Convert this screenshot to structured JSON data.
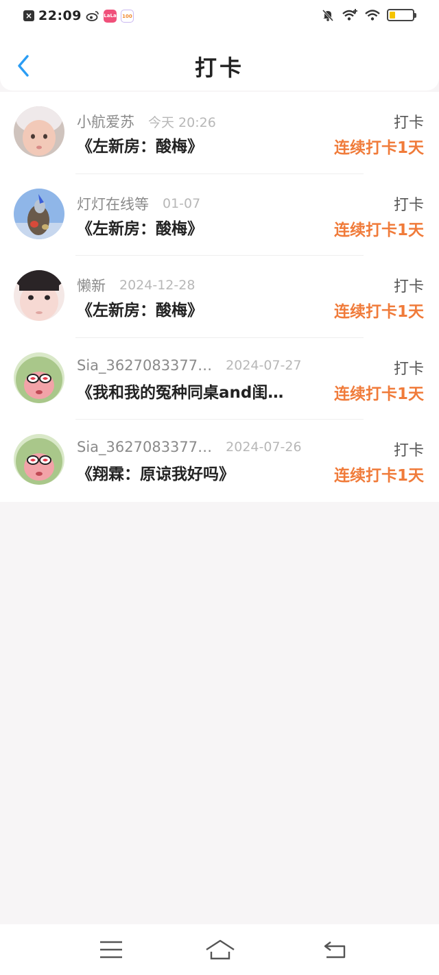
{
  "status_bar": {
    "time": "22:09",
    "app1_label": "LaLa",
    "app2_label": "100",
    "battery_level": 0.25
  },
  "header": {
    "title": "打卡"
  },
  "checkins": [
    {
      "username": "小航爱苏",
      "date": "今天 20:26",
      "song": "《左新房：酸梅》",
      "tag": "打卡",
      "streak": "连续打卡1天"
    },
    {
      "username": "灯灯在线等",
      "date": "01-07",
      "song": "《左新房：酸梅》",
      "tag": "打卡",
      "streak": "连续打卡1天"
    },
    {
      "username": "懒新",
      "date": "2024-12-28",
      "song": "《左新房：酸梅》",
      "tag": "打卡",
      "streak": "连续打卡1天"
    },
    {
      "username": "Sia_3627083377…",
      "date": "2024-07-27",
      "song": "《我和我的冤种同桌and闺…",
      "tag": "打卡",
      "streak": "连续打卡1天"
    },
    {
      "username": "Sia_3627083377…",
      "date": "2024-07-26",
      "song": "《翔霖：原谅我好吗》",
      "tag": "打卡",
      "streak": "连续打卡1天"
    }
  ],
  "colors": {
    "accent_blue": "#2a9df4",
    "streak_orange": "#f07b3a"
  }
}
